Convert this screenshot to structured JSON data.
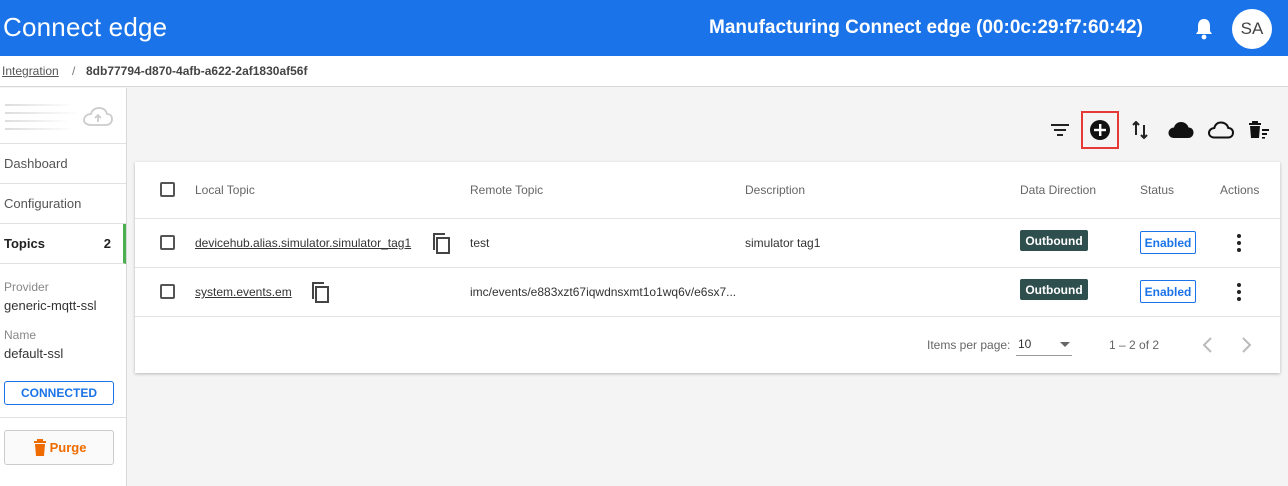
{
  "header": {
    "brand": "Connect edge",
    "device_title": "Manufacturing Connect edge (00:0c:29:f7:60:42)",
    "avatar_initials": "SA",
    "bar_color": "#1a73e8"
  },
  "breadcrumb": {
    "parent": "Integration",
    "separator": "/",
    "current": "8db77794-d870-4afb-a622-2af1830af56f"
  },
  "sidebar": {
    "items": [
      {
        "label": "Dashboard"
      },
      {
        "label": "Configuration"
      },
      {
        "label": "Topics",
        "count": "2",
        "active": true
      }
    ],
    "provider_label": "Provider",
    "provider_value": "generic-mqtt-ssl",
    "name_label": "Name",
    "name_value": "default-ssl",
    "status": "CONNECTED",
    "purge_label": "Purge"
  },
  "toolbar": {
    "icons": [
      "filter-icon",
      "add-circle-icon",
      "swap-vertical-icon",
      "cloud-filled-icon",
      "cloud-outline-icon",
      "delete-list-icon"
    ]
  },
  "table": {
    "columns": [
      "Local Topic",
      "Remote Topic",
      "Description",
      "Data Direction",
      "Status",
      "Actions"
    ],
    "rows": [
      {
        "local_topic": "devicehub.alias.simulator.simulator_tag1",
        "remote_topic": "test",
        "description": "simulator tag1",
        "direction": "Outbound",
        "status": "Enabled"
      },
      {
        "local_topic": "system.events.em",
        "remote_topic": "imc/events/e883xzt67iqwdnsxmt1o1wq6v/e6sx7...",
        "description": "",
        "direction": "Outbound",
        "status": "Enabled"
      }
    ]
  },
  "paginator": {
    "items_per_page_label": "Items per page:",
    "page_size": "10",
    "range": "1 – 2 of 2"
  },
  "colors": {
    "accent": "#1a73e8",
    "outbound_badge": "#2f4f4f",
    "purge": "#ef6c00",
    "active_marker": "#4caf50",
    "highlight": "#e53935"
  }
}
